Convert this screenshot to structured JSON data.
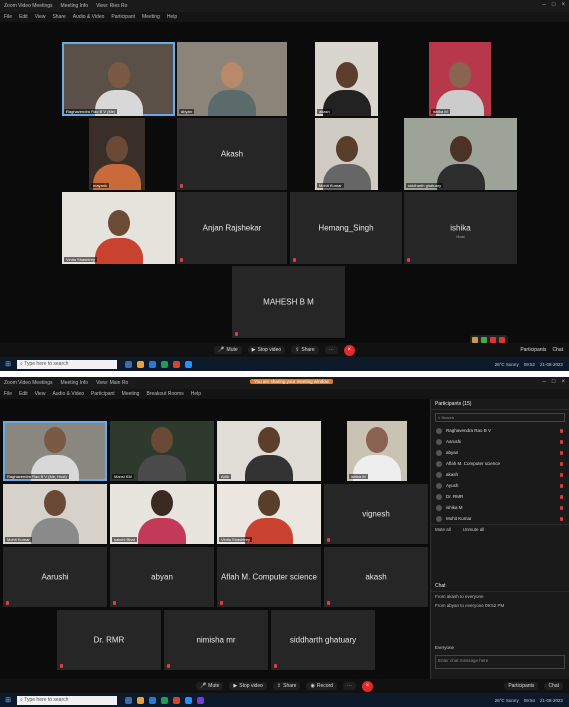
{
  "shot1": {
    "title": "Zoom Video Meetings",
    "title_extra": [
      "Meeting Info",
      "View: Ries Ro"
    ],
    "menu": [
      "File",
      "Edit",
      "View",
      "Share",
      "Audio & Video",
      "Participant",
      "Meeting",
      "Help"
    ],
    "tiles": [
      {
        "label": "Raghavendra Rao B V (Me)",
        "kind": "video"
      },
      {
        "label": "abyan",
        "kind": "video"
      },
      {
        "label": "akash",
        "kind": "video"
      },
      {
        "label": "ishika M",
        "kind": "video"
      },
      {
        "label": "mayank",
        "kind": "video"
      },
      {
        "name": "Akash",
        "kind": "name"
      },
      {
        "label": "Mohit Kumar",
        "kind": "video"
      },
      {
        "label": "siddharth ghatuary",
        "kind": "video"
      },
      {
        "label": "Vinita Shashtrey",
        "kind": "video"
      },
      {
        "name": "Anjan Rajshekar",
        "kind": "name"
      },
      {
        "name": "Hemang_Singh",
        "kind": "name"
      },
      {
        "name": "ishika",
        "sub": "Host",
        "kind": "name"
      },
      {
        "name": "MAHESH B M",
        "kind": "name"
      }
    ],
    "toolbar": {
      "mute": "Mute",
      "video": "Stop video",
      "share": "Share",
      "participants": "Participants",
      "chat": "Chat"
    },
    "taskbar": {
      "search": "Type here to search",
      "weather": "28°C Sunny",
      "time": "09:52",
      "date": "21-08-2022"
    }
  },
  "shot2": {
    "title": "Zoom Video Meetings",
    "title_extra": [
      "Meeting Info",
      "View: Main Ro"
    ],
    "recording_banner": "You are sharing your meeting window",
    "menu": [
      "File",
      "Edit",
      "View",
      "Audio & Video",
      "Participant",
      "Meeting",
      "Breakout Rooms",
      "Help"
    ],
    "tiles": [
      {
        "label": "Raghavendra Rao B V (Me, Host)",
        "kind": "video"
      },
      {
        "label": "Mansi KM",
        "kind": "video"
      },
      {
        "label": "Aditi",
        "kind": "video"
      },
      {
        "label": "ishika M",
        "kind": "video"
      },
      {
        "label": "Mohit Kumar",
        "kind": "video"
      },
      {
        "label": "sakshi Bhat",
        "kind": "video"
      },
      {
        "label": "Vinita Shashtrey",
        "kind": "video"
      },
      {
        "name": "vignesh",
        "kind": "name"
      },
      {
        "name": "Aarushi",
        "kind": "name"
      },
      {
        "name": "abyan",
        "kind": "name"
      },
      {
        "name": "Aflah M. Computer science",
        "kind": "name"
      },
      {
        "name": "akash",
        "kind": "name"
      },
      {
        "name": "Dr. RMR",
        "kind": "name"
      },
      {
        "name": "nimisha mr",
        "kind": "name"
      },
      {
        "name": "siddharth ghatuary",
        "kind": "name"
      }
    ],
    "participants": {
      "header": "Participants (15)",
      "search": "Search",
      "list": [
        "Raghavendra Rao B V",
        "Aarushi",
        "abyan",
        "Aflah M. Computer science",
        "akash",
        "Ayush",
        "Dr. RMR",
        "ishika M",
        "Mohit Kumar"
      ],
      "footer": [
        "Mute all",
        "Unmute all"
      ]
    },
    "chat": {
      "header": "Chat",
      "messages": [
        "From akash to everyone",
        "From abyan to everyone 09:52 PM"
      ],
      "to": "Everyone",
      "placeholder": "Enter chat message here"
    },
    "toolbar": {
      "mute": "Mute",
      "video": "Stop video",
      "share": "Share",
      "record": "Record",
      "participants": "Participants",
      "chat": "Chat"
    },
    "taskbar": {
      "search": "Type here to search",
      "weather": "28°C Sunny",
      "time": "09:54",
      "date": "21-08-2022"
    }
  }
}
